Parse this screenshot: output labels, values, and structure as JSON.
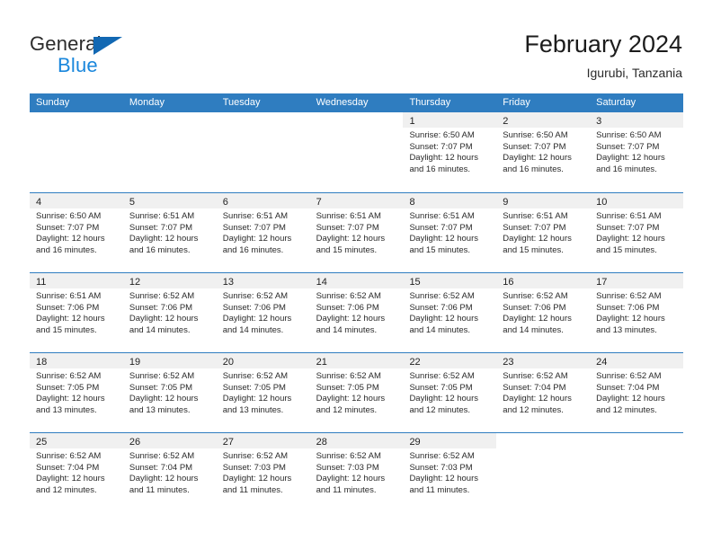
{
  "brand": {
    "word_one": "General",
    "word_two": "Blue",
    "triangle_color": "#1268b3",
    "blue_text_color": "#1a87dc"
  },
  "header": {
    "title": "February 2024",
    "subtitle": "Igurubi, Tanzania"
  },
  "theme": {
    "header_row_bg": "#2f7dc0",
    "day_band_bg": "#f0f0f0",
    "row_divider": "#2f7dc0"
  },
  "weekday_headers": [
    "Sunday",
    "Monday",
    "Tuesday",
    "Wednesday",
    "Thursday",
    "Friday",
    "Saturday"
  ],
  "weeks": [
    [
      {
        "day": "",
        "blank": true
      },
      {
        "day": "",
        "blank": true
      },
      {
        "day": "",
        "blank": true
      },
      {
        "day": "",
        "blank": true
      },
      {
        "day": "1",
        "sunrise": "Sunrise: 6:50 AM",
        "sunset": "Sunset: 7:07 PM",
        "daylight_1": "Daylight: 12 hours",
        "daylight_2": "and 16 minutes."
      },
      {
        "day": "2",
        "sunrise": "Sunrise: 6:50 AM",
        "sunset": "Sunset: 7:07 PM",
        "daylight_1": "Daylight: 12 hours",
        "daylight_2": "and 16 minutes."
      },
      {
        "day": "3",
        "sunrise": "Sunrise: 6:50 AM",
        "sunset": "Sunset: 7:07 PM",
        "daylight_1": "Daylight: 12 hours",
        "daylight_2": "and 16 minutes."
      }
    ],
    [
      {
        "day": "4",
        "sunrise": "Sunrise: 6:50 AM",
        "sunset": "Sunset: 7:07 PM",
        "daylight_1": "Daylight: 12 hours",
        "daylight_2": "and 16 minutes."
      },
      {
        "day": "5",
        "sunrise": "Sunrise: 6:51 AM",
        "sunset": "Sunset: 7:07 PM",
        "daylight_1": "Daylight: 12 hours",
        "daylight_2": "and 16 minutes."
      },
      {
        "day": "6",
        "sunrise": "Sunrise: 6:51 AM",
        "sunset": "Sunset: 7:07 PM",
        "daylight_1": "Daylight: 12 hours",
        "daylight_2": "and 16 minutes."
      },
      {
        "day": "7",
        "sunrise": "Sunrise: 6:51 AM",
        "sunset": "Sunset: 7:07 PM",
        "daylight_1": "Daylight: 12 hours",
        "daylight_2": "and 15 minutes."
      },
      {
        "day": "8",
        "sunrise": "Sunrise: 6:51 AM",
        "sunset": "Sunset: 7:07 PM",
        "daylight_1": "Daylight: 12 hours",
        "daylight_2": "and 15 minutes."
      },
      {
        "day": "9",
        "sunrise": "Sunrise: 6:51 AM",
        "sunset": "Sunset: 7:07 PM",
        "daylight_1": "Daylight: 12 hours",
        "daylight_2": "and 15 minutes."
      },
      {
        "day": "10",
        "sunrise": "Sunrise: 6:51 AM",
        "sunset": "Sunset: 7:07 PM",
        "daylight_1": "Daylight: 12 hours",
        "daylight_2": "and 15 minutes."
      }
    ],
    [
      {
        "day": "11",
        "sunrise": "Sunrise: 6:51 AM",
        "sunset": "Sunset: 7:06 PM",
        "daylight_1": "Daylight: 12 hours",
        "daylight_2": "and 15 minutes."
      },
      {
        "day": "12",
        "sunrise": "Sunrise: 6:52 AM",
        "sunset": "Sunset: 7:06 PM",
        "daylight_1": "Daylight: 12 hours",
        "daylight_2": "and 14 minutes."
      },
      {
        "day": "13",
        "sunrise": "Sunrise: 6:52 AM",
        "sunset": "Sunset: 7:06 PM",
        "daylight_1": "Daylight: 12 hours",
        "daylight_2": "and 14 minutes."
      },
      {
        "day": "14",
        "sunrise": "Sunrise: 6:52 AM",
        "sunset": "Sunset: 7:06 PM",
        "daylight_1": "Daylight: 12 hours",
        "daylight_2": "and 14 minutes."
      },
      {
        "day": "15",
        "sunrise": "Sunrise: 6:52 AM",
        "sunset": "Sunset: 7:06 PM",
        "daylight_1": "Daylight: 12 hours",
        "daylight_2": "and 14 minutes."
      },
      {
        "day": "16",
        "sunrise": "Sunrise: 6:52 AM",
        "sunset": "Sunset: 7:06 PM",
        "daylight_1": "Daylight: 12 hours",
        "daylight_2": "and 14 minutes."
      },
      {
        "day": "17",
        "sunrise": "Sunrise: 6:52 AM",
        "sunset": "Sunset: 7:06 PM",
        "daylight_1": "Daylight: 12 hours",
        "daylight_2": "and 13 minutes."
      }
    ],
    [
      {
        "day": "18",
        "sunrise": "Sunrise: 6:52 AM",
        "sunset": "Sunset: 7:05 PM",
        "daylight_1": "Daylight: 12 hours",
        "daylight_2": "and 13 minutes."
      },
      {
        "day": "19",
        "sunrise": "Sunrise: 6:52 AM",
        "sunset": "Sunset: 7:05 PM",
        "daylight_1": "Daylight: 12 hours",
        "daylight_2": "and 13 minutes."
      },
      {
        "day": "20",
        "sunrise": "Sunrise: 6:52 AM",
        "sunset": "Sunset: 7:05 PM",
        "daylight_1": "Daylight: 12 hours",
        "daylight_2": "and 13 minutes."
      },
      {
        "day": "21",
        "sunrise": "Sunrise: 6:52 AM",
        "sunset": "Sunset: 7:05 PM",
        "daylight_1": "Daylight: 12 hours",
        "daylight_2": "and 12 minutes."
      },
      {
        "day": "22",
        "sunrise": "Sunrise: 6:52 AM",
        "sunset": "Sunset: 7:05 PM",
        "daylight_1": "Daylight: 12 hours",
        "daylight_2": "and 12 minutes."
      },
      {
        "day": "23",
        "sunrise": "Sunrise: 6:52 AM",
        "sunset": "Sunset: 7:04 PM",
        "daylight_1": "Daylight: 12 hours",
        "daylight_2": "and 12 minutes."
      },
      {
        "day": "24",
        "sunrise": "Sunrise: 6:52 AM",
        "sunset": "Sunset: 7:04 PM",
        "daylight_1": "Daylight: 12 hours",
        "daylight_2": "and 12 minutes."
      }
    ],
    [
      {
        "day": "25",
        "sunrise": "Sunrise: 6:52 AM",
        "sunset": "Sunset: 7:04 PM",
        "daylight_1": "Daylight: 12 hours",
        "daylight_2": "and 12 minutes."
      },
      {
        "day": "26",
        "sunrise": "Sunrise: 6:52 AM",
        "sunset": "Sunset: 7:04 PM",
        "daylight_1": "Daylight: 12 hours",
        "daylight_2": "and 11 minutes."
      },
      {
        "day": "27",
        "sunrise": "Sunrise: 6:52 AM",
        "sunset": "Sunset: 7:03 PM",
        "daylight_1": "Daylight: 12 hours",
        "daylight_2": "and 11 minutes."
      },
      {
        "day": "28",
        "sunrise": "Sunrise: 6:52 AM",
        "sunset": "Sunset: 7:03 PM",
        "daylight_1": "Daylight: 12 hours",
        "daylight_2": "and 11 minutes."
      },
      {
        "day": "29",
        "sunrise": "Sunrise: 6:52 AM",
        "sunset": "Sunset: 7:03 PM",
        "daylight_1": "Daylight: 12 hours",
        "daylight_2": "and 11 minutes."
      },
      {
        "day": "",
        "blank": true
      },
      {
        "day": "",
        "blank": true
      }
    ]
  ]
}
